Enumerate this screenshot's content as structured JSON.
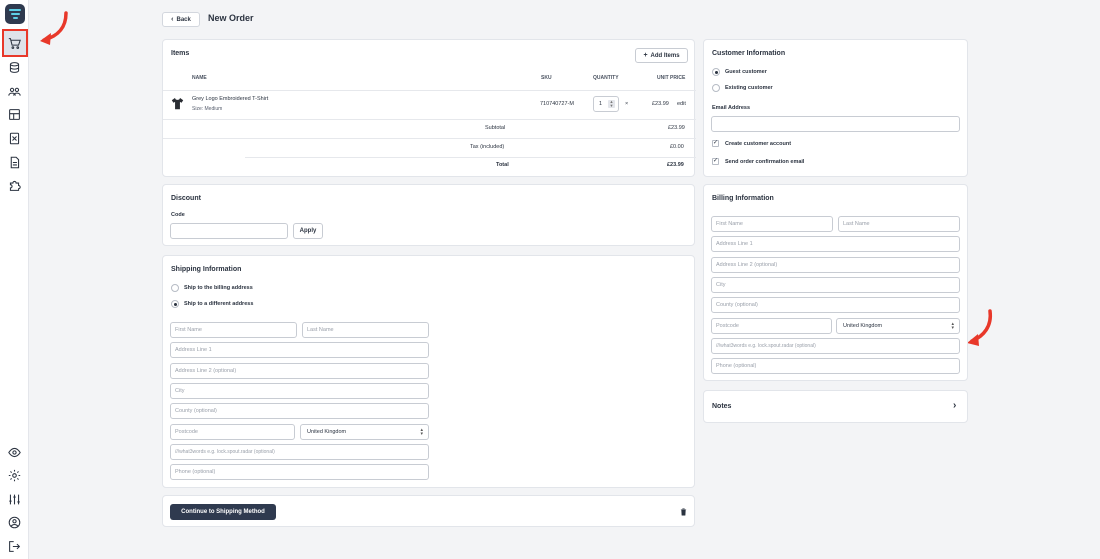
{
  "sidebar": {
    "icons": [
      "logo-icon",
      "cart-icon",
      "database-icon",
      "users-icon",
      "layout-icon",
      "calculator-icon",
      "document-icon",
      "puzzle-icon",
      "eye-icon",
      "gear-icon",
      "sliders-icon",
      "user-icon",
      "logout-icon"
    ]
  },
  "header": {
    "back_label": "Back",
    "title": "New Order"
  },
  "items": {
    "title": "Items",
    "add_label": "Add Items",
    "columns": {
      "name": "NAME",
      "sku": "SKU",
      "quantity": "QUANTITY",
      "unit_price": "UNIT PRICE"
    },
    "rows": [
      {
        "name": "Grey Logo Embroidered T-Shirt",
        "variant": "Size: Medium",
        "sku": "710740727-M",
        "quantity": "1",
        "remove": "×",
        "price": "£23.99",
        "edit": "edit"
      }
    ],
    "subtotal_label": "Subtotal",
    "subtotal": "£23.99",
    "tax_label": "Tax (included)",
    "tax": "£0.00",
    "total_label": "Total",
    "total": "£23.99"
  },
  "discount": {
    "title": "Discount",
    "code_label": "Code",
    "code_value": "",
    "apply_label": "Apply"
  },
  "shipping": {
    "title": "Shipping Information",
    "option_billing": "Ship to the billing address",
    "option_different": "Ship to a different address",
    "first_name": "First Name",
    "last_name": "Last Name",
    "address1": "Address Line 1",
    "address2": "Address Line 2 (optional)",
    "city": "City",
    "county": "County (optional)",
    "postcode": "Postcode",
    "country": "United Kingdom",
    "what3words": "///what3words e.g. lock.spout.radar (optional)",
    "phone": "Phone (optional)"
  },
  "footer": {
    "continue_label": "Continue to Shipping Method"
  },
  "customer": {
    "title": "Customer Information",
    "guest": "Guest customer",
    "existing": "Existing customer",
    "email_label": "Email Address",
    "email_value": "",
    "create_account": "Create customer account",
    "send_confirmation": "Send order confirmation email"
  },
  "billing": {
    "title": "Billing Information",
    "first_name": "First Name",
    "last_name": "Last Name",
    "address1": "Address Line 1",
    "address2": "Address Line 2 (optional)",
    "city": "City",
    "county": "County (optional)",
    "postcode": "Postcode",
    "country": "United Kingdom",
    "what3words": "///what3words e.g. lock.spout.radar (optional)",
    "phone": "Phone (optional)"
  },
  "notes": {
    "title": "Notes"
  },
  "colors": {
    "accent": "#2f3a4f",
    "highlight": "#e8382a",
    "brand": "#5fd0e6"
  }
}
